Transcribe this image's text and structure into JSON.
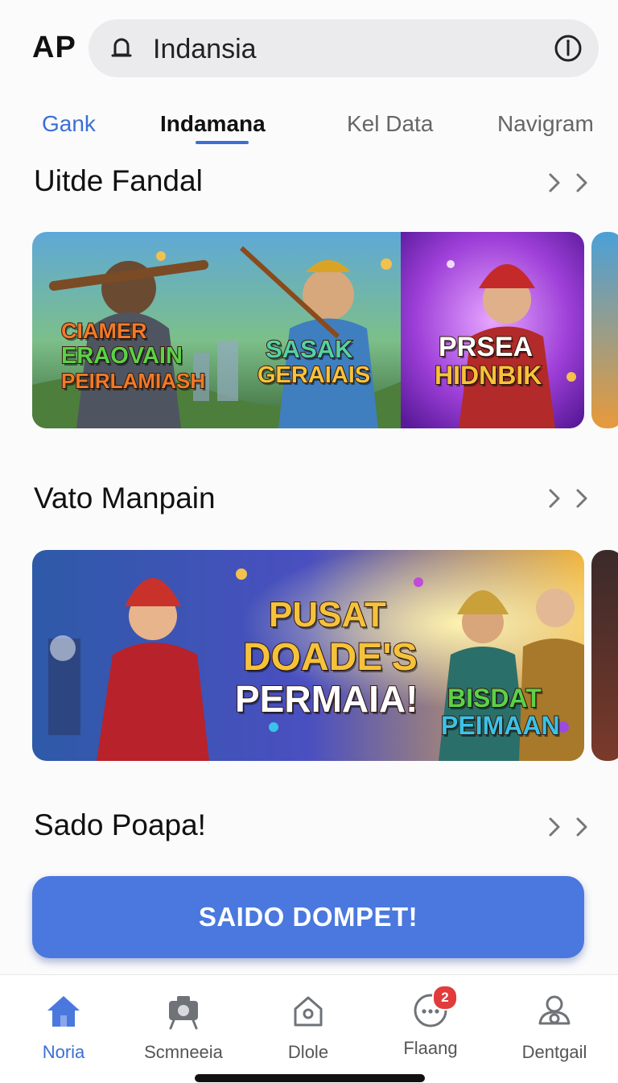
{
  "header": {
    "logo": "AP",
    "search_value": "Indansia",
    "icons": {
      "left": "bell-icon",
      "right": "info-icon"
    }
  },
  "tabs": [
    {
      "label": "Gank",
      "state": "accent"
    },
    {
      "label": "Indamana",
      "state": "selected"
    },
    {
      "label": "Kel Data",
      "state": "default"
    },
    {
      "label": "Navigram",
      "state": "default"
    }
  ],
  "sections": [
    {
      "title": "Uitde Fandal",
      "banners": [
        {
          "lines": [
            "CIAMER",
            "ERAOVAIN",
            "PEIRLAMIASH"
          ]
        },
        {
          "lines": [
            "SASAK",
            "GERAIAIS"
          ]
        },
        {
          "lines": [
            "PRSEA",
            "HIDNBIK"
          ]
        }
      ]
    },
    {
      "title": "Vato Manpain",
      "banners": [
        {
          "lines": [
            "PUSAT",
            "DOADE'S",
            "PERMAIA!"
          ]
        },
        {
          "lines": [
            "BISDAT",
            "PEIMAAN"
          ]
        }
      ]
    },
    {
      "title": "Sado Poapa!"
    }
  ],
  "cta": {
    "label": "SAIDO DOMPET!"
  },
  "bottom_nav": [
    {
      "label": "Noria",
      "icon": "home-icon",
      "active": true
    },
    {
      "label": "Scmneeia",
      "icon": "camera-icon",
      "active": false
    },
    {
      "label": "Dlole",
      "icon": "house-outline-icon",
      "active": false
    },
    {
      "label": "Flaang",
      "icon": "chat-icon",
      "active": false,
      "badge": "2"
    },
    {
      "label": "Dentgail",
      "icon": "profile-icon",
      "active": false
    }
  ],
  "colors": {
    "accent": "#3b6fd4",
    "cta": "#4a78df",
    "badge": "#e23b3b"
  }
}
